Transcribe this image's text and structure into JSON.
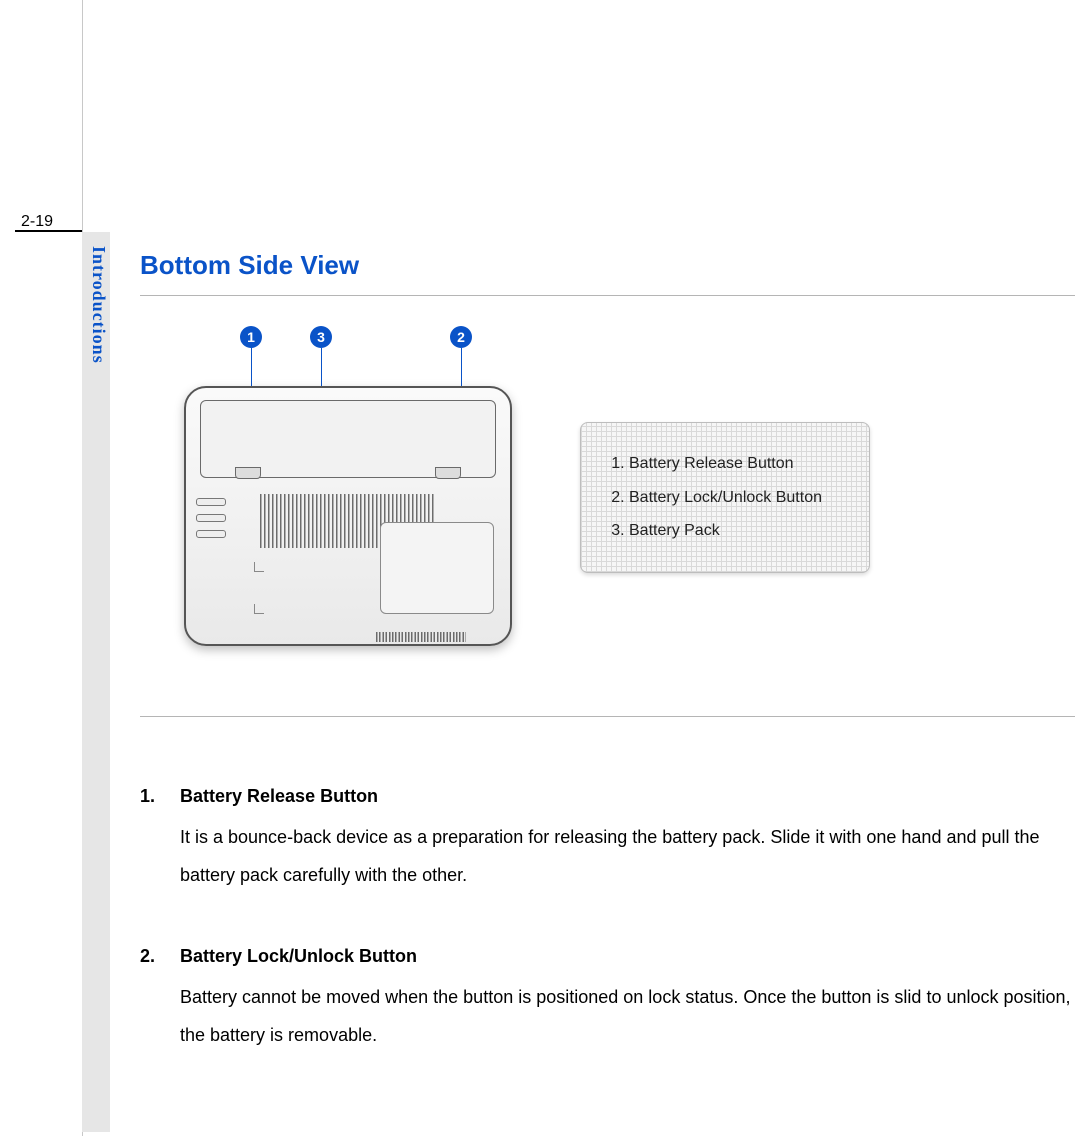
{
  "page_number": "2-19",
  "sidebar_label": "Introductions",
  "section_title": "Bottom Side View",
  "callouts": {
    "n1": "1",
    "n2": "2",
    "n3": "3"
  },
  "legend": {
    "items": [
      "Battery Release Button",
      "Battery Lock/Unlock Button",
      "Battery Pack"
    ]
  },
  "descriptions": [
    {
      "title": "Battery Release Button",
      "body": "It is a bounce-back device as a preparation for releasing the battery pack. Slide it with one hand and pull the battery pack carefully with the other."
    },
    {
      "title": "Battery Lock/Unlock Button",
      "body": "Battery cannot be moved when the button is positioned on lock status. Once the button is slid to unlock position, the battery is removable."
    }
  ]
}
